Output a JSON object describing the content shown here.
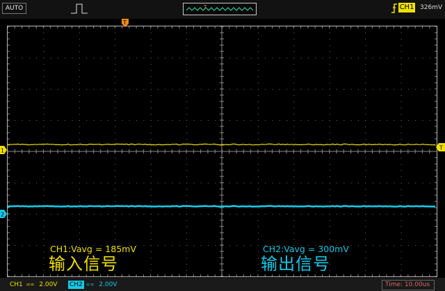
{
  "header": {
    "mode": "AUTO",
    "trigger_channel": "CH1",
    "trigger_level": "326mV",
    "trigger_window_marker": "T"
  },
  "markers": {
    "ch1": "1",
    "ch2": "2",
    "trigger": "T",
    "trigger_level": "T"
  },
  "measurements": {
    "ch1_text": "CH1:Vavg = 185mV",
    "ch1_label": "输入信号",
    "ch2_text": "CH2:Vavg = 300mV",
    "ch2_label": "输出信号"
  },
  "footer": {
    "ch1_name": "CH1",
    "ch1_coupling": "==",
    "ch1_scale": "2.00V",
    "ch2_name": "CH2",
    "ch2_coupling": "==",
    "ch2_scale": "2.00V",
    "time": "Time: 10.00us"
  },
  "colors": {
    "ch1": "#f0e000",
    "ch2": "#16c8e8",
    "trigger": "#f08a1c",
    "grid": "#777777",
    "background": "#000000"
  }
}
